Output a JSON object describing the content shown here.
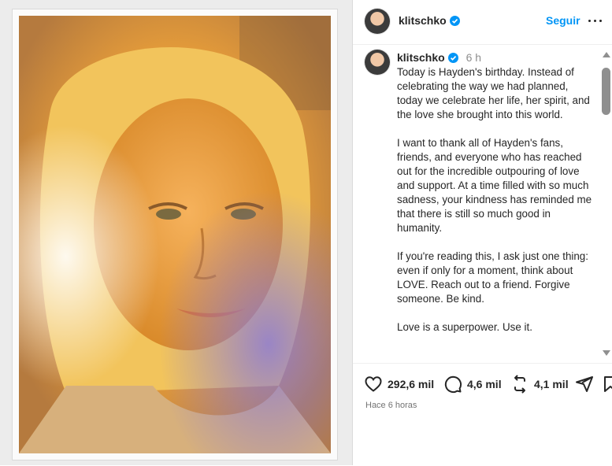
{
  "post": {
    "username": "klitschko",
    "follow_label": "Seguir",
    "relative_time": "6 h",
    "caption_paragraphs": [
      "Today is Hayden's birthday. Instead of celebrating the way we had planned, today we celebrate her life, her spirit, and the love she brought into this world.",
      "I want to thank all of Hayden's fans, friends, and everyone who has reached out for the incredible outpouring of love and support. At a time filled with so much sadness, your kindness has reminded me that there is still so much good in humanity.",
      "If you're reading this, I ask just one thing: even if only for a moment, think about LOVE. Reach out to a friend. Forgive someone. Be kind.",
      "Love is a superpower. Use it."
    ],
    "likes": "292,6 mil",
    "comments": "4,6 mil",
    "reposts": "4,1 mil",
    "timestamp": "Hace 6 horas"
  },
  "colors": {
    "accent": "#0095f6",
    "verified": "#0095f6",
    "text": "#262626",
    "muted": "#8e8e8e"
  },
  "icons": {
    "like": "heart-icon",
    "comment": "comment-icon",
    "repost": "repost-icon",
    "share": "share-icon",
    "save": "bookmark-icon",
    "more": "more-icon",
    "verified": "verified-badge-icon"
  }
}
